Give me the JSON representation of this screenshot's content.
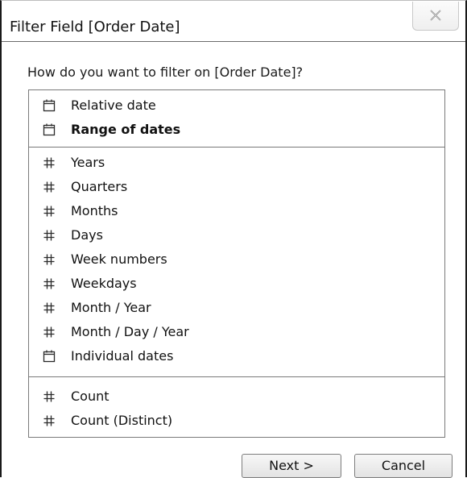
{
  "dialog": {
    "title": "Filter Field [Order Date]",
    "close_icon": "close-icon",
    "prompt": "How do you want to filter on [Order Date]?"
  },
  "list": {
    "items": [
      {
        "label": "Relative date",
        "icon": "calendar-icon",
        "bold": false
      },
      {
        "label": "Range of dates",
        "icon": "calendar-icon",
        "bold": true
      },
      {
        "label": "Years",
        "icon": "hash-icon",
        "bold": false
      },
      {
        "label": "Quarters",
        "icon": "hash-icon",
        "bold": false
      },
      {
        "label": "Months",
        "icon": "hash-icon",
        "bold": false
      },
      {
        "label": "Days",
        "icon": "hash-icon",
        "bold": false
      },
      {
        "label": "Week numbers",
        "icon": "hash-icon",
        "bold": false
      },
      {
        "label": "Weekdays",
        "icon": "hash-icon",
        "bold": false
      },
      {
        "label": "Month / Year",
        "icon": "hash-icon",
        "bold": false
      },
      {
        "label": "Month / Day / Year",
        "icon": "hash-icon",
        "bold": false
      },
      {
        "label": "Individual dates",
        "icon": "calendar-icon",
        "bold": false
      },
      {
        "label": "Count",
        "icon": "hash-icon",
        "bold": false
      },
      {
        "label": "Count (Distinct)",
        "icon": "hash-icon",
        "bold": false
      }
    ]
  },
  "buttons": {
    "next_label": "Next >",
    "cancel_label": "Cancel"
  }
}
